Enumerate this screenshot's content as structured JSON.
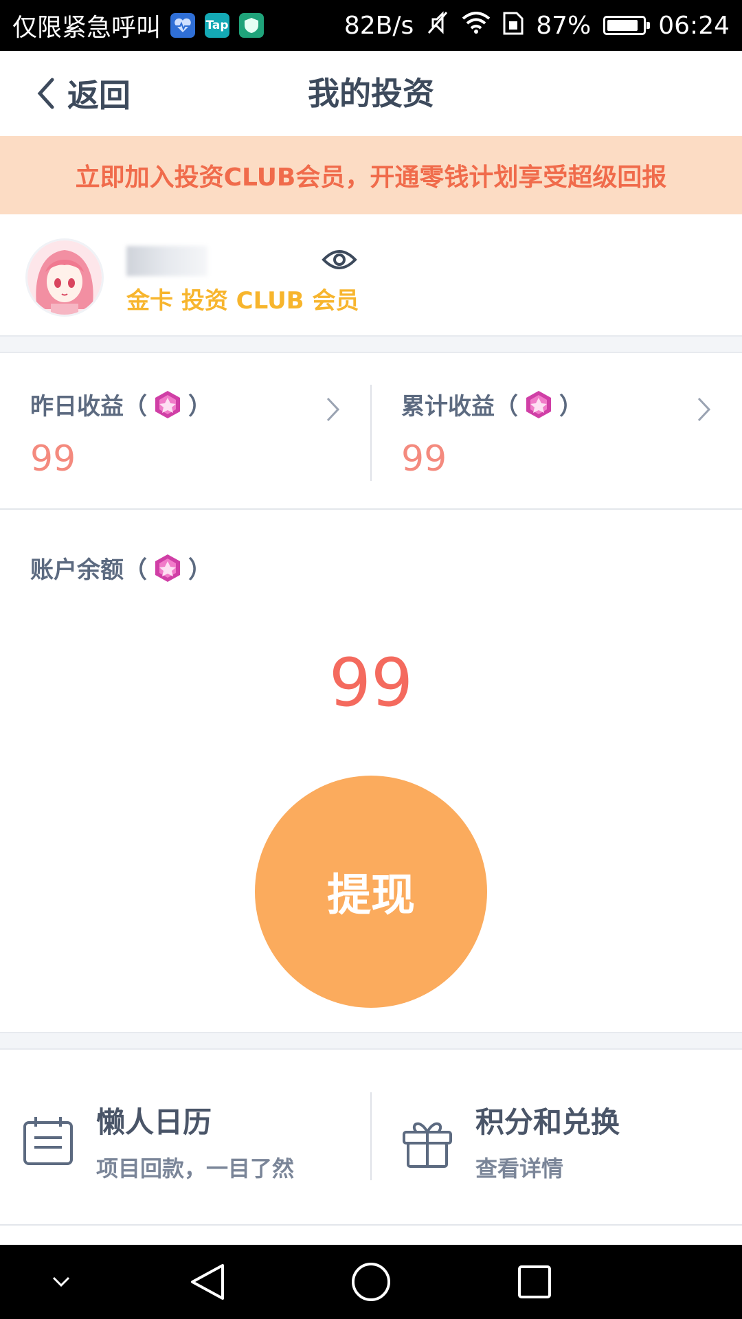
{
  "status_bar": {
    "carrier_text": "仅限紧急呼叫",
    "net_speed": "82B/s",
    "battery_percent_label": "87%",
    "battery_level": 0.87,
    "time": "06:24",
    "app_icons": [
      "heart-pulse-icon",
      "tap-icon",
      "shield-icon"
    ],
    "tap_label": "Tap"
  },
  "nav": {
    "back_label": "返回",
    "title": "我的投资"
  },
  "promo": {
    "text": "立即加入投资CLUB会员，开通零钱计划享受超级回报"
  },
  "profile": {
    "name": "███",
    "membership": "金卡 投资 CLUB 会员"
  },
  "earnings": {
    "yesterday": {
      "label": "昨日收益（",
      "suffix": "）",
      "value": "99"
    },
    "total": {
      "label": "累计收益（",
      "suffix": "）",
      "value": "99"
    }
  },
  "balance": {
    "label": "账户余额（",
    "suffix": "）",
    "value": "99",
    "withdraw_label": "提现"
  },
  "features": [
    {
      "title": "懒人日历",
      "subtitle": "项目回款，一目了然",
      "icon": "calendar-icon"
    },
    {
      "title": "积分和兑换",
      "subtitle": "查看详情",
      "icon": "gift-icon"
    }
  ],
  "colors": {
    "accent_orange": "#fbab5d",
    "promo_bg": "#fcdcc4",
    "promo_text": "#f06b4b",
    "value_red": "#f46a5e",
    "member_gold": "#f7b52d"
  }
}
